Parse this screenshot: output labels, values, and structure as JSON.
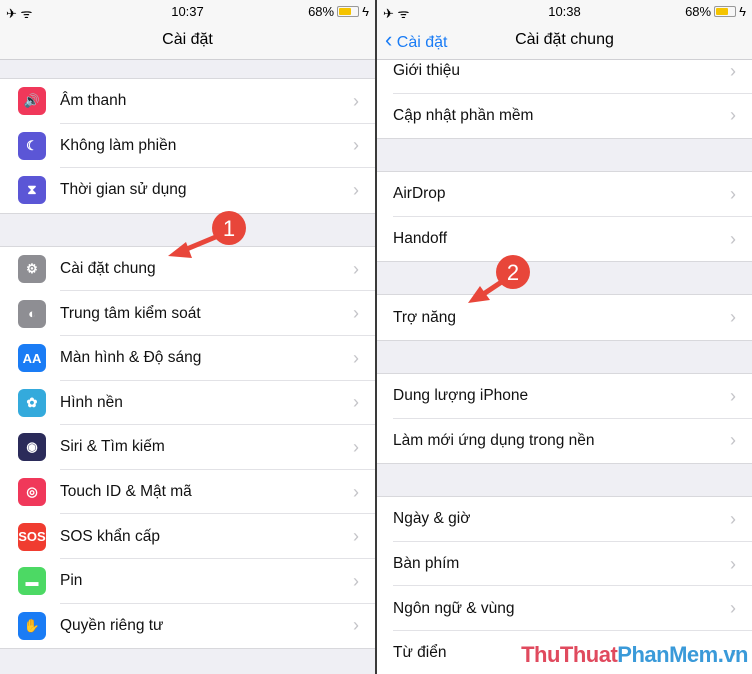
{
  "left": {
    "status": {
      "time": "10:37",
      "battery": "68%",
      "battery_level": 0.68
    },
    "nav_title": "Cài đặt",
    "groups": [
      [
        {
          "label": "Âm thanh",
          "icon": "speaker-icon",
          "color": "#f0385a",
          "glyph": "🔊"
        },
        {
          "label": "Không làm phiền",
          "icon": "moon-icon",
          "color": "#5b56d6",
          "glyph": "☾"
        },
        {
          "label": "Thời gian sử dụng",
          "icon": "hourglass-icon",
          "color": "#5b56d6",
          "glyph": "⧗"
        }
      ],
      [
        {
          "label": "Cài đặt chung",
          "icon": "gear-icon",
          "color": "#8e8e93",
          "glyph": "⚙"
        },
        {
          "label": "Trung tâm kiểm soát",
          "icon": "toggles-icon",
          "color": "#8e8e93",
          "glyph": "◐"
        },
        {
          "label": "Màn hình & Độ sáng",
          "icon": "text-size-icon",
          "color": "#1a7cf5",
          "glyph": "AA"
        },
        {
          "label": "Hình nền",
          "icon": "flower-icon",
          "color": "#34aadc",
          "glyph": "✿"
        },
        {
          "label": "Siri & Tìm kiếm",
          "icon": "siri-icon",
          "color": "#2b2b5a",
          "glyph": "◉"
        },
        {
          "label": "Touch ID & Mật mã",
          "icon": "fingerprint-icon",
          "color": "#f0385a",
          "glyph": "◎"
        },
        {
          "label": "SOS khẩn cấp",
          "icon": "sos-icon",
          "color": "#f03c30",
          "glyph": "SOS"
        },
        {
          "label": "Pin",
          "icon": "battery-icon",
          "color": "#4cd964",
          "glyph": "▬"
        },
        {
          "label": "Quyền riêng tư",
          "icon": "hand-icon",
          "color": "#1a7cf5",
          "glyph": "✋"
        }
      ]
    ]
  },
  "right": {
    "status": {
      "time": "10:38",
      "battery": "68%",
      "battery_level": 0.68
    },
    "back_label": "Cài đặt",
    "nav_title": "Cài đặt chung",
    "groups": [
      [
        {
          "label": "Giới thiệu"
        },
        {
          "label": "Cập nhật phần mềm"
        }
      ],
      [
        {
          "label": "AirDrop"
        },
        {
          "label": "Handoff"
        }
      ],
      [
        {
          "label": "Trợ năng"
        }
      ],
      [
        {
          "label": "Dung lượng iPhone"
        },
        {
          "label": "Làm mới ứng dụng trong nền"
        }
      ],
      [
        {
          "label": "Ngày & giờ"
        },
        {
          "label": "Bàn phím"
        },
        {
          "label": "Ngôn ngữ & vùng"
        },
        {
          "label": "Từ điển"
        }
      ]
    ]
  },
  "annotations": [
    {
      "number": "1"
    },
    {
      "number": "2"
    }
  ],
  "watermark": {
    "part1": "ThuThuat",
    "part2": "PhanMem.vn",
    "color1": "#e04a5e",
    "color2": "#3a9ad9"
  },
  "colors": {
    "accent": "#1a7cf5",
    "arrow": "#e8463a"
  }
}
